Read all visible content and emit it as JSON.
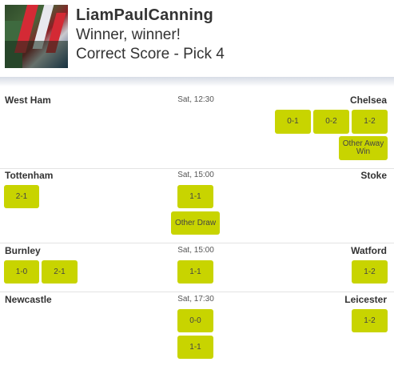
{
  "header": {
    "username": "LiamPaulCanning",
    "line1": "Winner, winner!",
    "line2": "Correct Score - Pick 4"
  },
  "matches": [
    {
      "home": "West Ham",
      "time": "Sat, 12:30",
      "away": "Chelsea",
      "home_picks": [],
      "draw_picks": [],
      "away_picks": [
        "0-1",
        "0-2",
        "1-2",
        "Other Away Win"
      ]
    },
    {
      "home": "Tottenham",
      "time": "Sat, 15:00",
      "away": "Stoke",
      "home_picks": [
        "2-1"
      ],
      "draw_picks": [
        "1-1",
        "Other Draw"
      ],
      "away_picks": []
    },
    {
      "home": "Burnley",
      "time": "Sat, 15:00",
      "away": "Watford",
      "home_picks": [
        "1-0",
        "2-1"
      ],
      "draw_picks": [
        "1-1"
      ],
      "away_picks": [
        "1-2"
      ]
    },
    {
      "home": "Newcastle",
      "time": "Sat, 17:30",
      "away": "Leicester",
      "home_picks": [],
      "draw_picks": [
        "0-0",
        "1-1"
      ],
      "away_picks": [
        "1-2"
      ]
    }
  ],
  "colors": {
    "pick_button": "#c8d400",
    "divider": "#e3e3e3"
  }
}
